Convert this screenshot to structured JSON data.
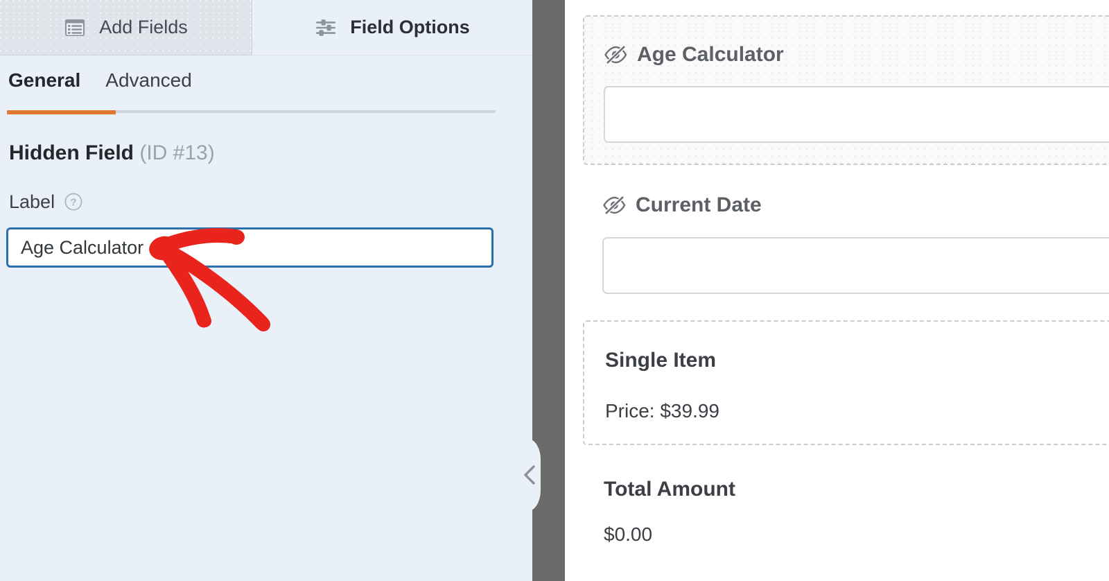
{
  "panel": {
    "tabs": [
      {
        "label": "Add Fields",
        "icon": "form-list-icon",
        "active": false
      },
      {
        "label": "Field Options",
        "icon": "sliders-icon",
        "active": true
      }
    ],
    "subtabs": [
      {
        "label": "General",
        "active": true
      },
      {
        "label": "Advanced",
        "active": false
      }
    ],
    "field_heading": {
      "type": "Hidden Field",
      "id": "(ID #13)"
    },
    "label_field": {
      "label": "Label",
      "help_icon": "question-circle-icon",
      "value": "Age Calculator",
      "placeholder": ""
    },
    "collapse_handle": {
      "icon": "chevron-left-icon"
    }
  },
  "preview": {
    "fields": [
      {
        "name": "age-calculator",
        "label": "Age Calculator",
        "icon": "eye-slash-icon",
        "hidden": true,
        "highlighted": true,
        "input_value": "",
        "input_placeholder": ""
      },
      {
        "name": "current-date",
        "label": "Current Date",
        "icon": "eye-slash-icon",
        "hidden": true,
        "highlighted": false,
        "input_value": "",
        "input_placeholder": ""
      },
      {
        "name": "single-item",
        "title": "Single Item",
        "subtitle": "Price: $39.99",
        "highlighted": true
      },
      {
        "name": "total-amount",
        "title": "Total Amount",
        "subtitle": "$0.00",
        "highlighted": false
      }
    ]
  },
  "annotation": {
    "type": "hand-drawn-arrow",
    "color": "#e8241c",
    "points_to": "label-input"
  },
  "colors": {
    "accent_orange": "#e27730",
    "focus_blue": "#2c6fae",
    "panel_bg": "#eaf0f8",
    "tab_inactive_bg": "#e0e4ea",
    "divider_grey": "#6a6a6a",
    "annotation_red": "#e8241c"
  }
}
